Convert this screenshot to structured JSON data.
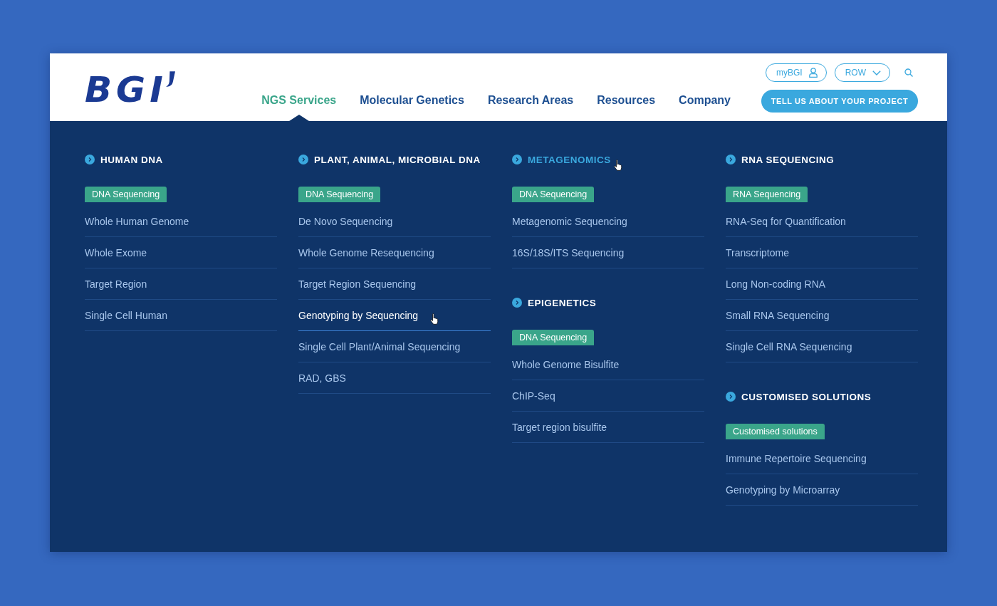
{
  "header": {
    "logo": "BGI",
    "nav": [
      {
        "label": "NGS Services",
        "selected": true
      },
      {
        "label": "Molecular Genetics",
        "selected": false
      },
      {
        "label": "Research Areas",
        "selected": false
      },
      {
        "label": "Resources",
        "selected": false
      },
      {
        "label": "Company",
        "selected": false
      }
    ],
    "account_button": "myBGI",
    "region_selector": "ROW",
    "cta_button": "TELL US ABOUT YOUR PROJECT"
  },
  "mega_menu": {
    "columns": [
      {
        "sections": [
          {
            "title": "HUMAN DNA",
            "hovered": false,
            "tag": "DNA Sequencing",
            "items": [
              {
                "label": "Whole Human Genome",
                "hovered": false
              },
              {
                "label": "Whole Exome",
                "hovered": false
              },
              {
                "label": "Target Region",
                "hovered": false
              },
              {
                "label": "Single Cell Human",
                "hovered": false
              }
            ]
          }
        ]
      },
      {
        "sections": [
          {
            "title": "PLANT, ANIMAL, MICROBIAL DNA",
            "hovered": false,
            "tag": "DNA Sequencing",
            "items": [
              {
                "label": "De Novo Sequencing",
                "hovered": false
              },
              {
                "label": "Whole Genome Resequencing",
                "hovered": false
              },
              {
                "label": "Target Region Sequencing",
                "hovered": false
              },
              {
                "label": "Genotyping by Sequencing",
                "hovered": true
              },
              {
                "label": "Single Cell Plant/Animal Sequencing",
                "hovered": false
              },
              {
                "label": "RAD, GBS",
                "hovered": false
              }
            ]
          }
        ]
      },
      {
        "sections": [
          {
            "title": "METAGENOMICS",
            "hovered": true,
            "tag": "DNA Sequencing",
            "items": [
              {
                "label": "Metagenomic Sequencing",
                "hovered": false
              },
              {
                "label": "16S/18S/ITS Sequencing",
                "hovered": false
              }
            ]
          },
          {
            "title": "EPIGENETICS",
            "hovered": false,
            "tag": "DNA Sequencing",
            "items": [
              {
                "label": "Whole Genome Bisulfite",
                "hovered": false
              },
              {
                "label": "ChIP-Seq",
                "hovered": false
              },
              {
                "label": "Target region bisulfite",
                "hovered": false
              }
            ]
          }
        ]
      },
      {
        "sections": [
          {
            "title": "RNA SEQUENCING",
            "hovered": false,
            "tag": "RNA Sequencing",
            "items": [
              {
                "label": "RNA-Seq for Quantification",
                "hovered": false
              },
              {
                "label": "Transcriptome",
                "hovered": false
              },
              {
                "label": "Long Non-coding RNA",
                "hovered": false
              },
              {
                "label": "Small RNA Sequencing",
                "hovered": false
              },
              {
                "label": "Single Cell RNA Sequencing",
                "hovered": false
              }
            ]
          },
          {
            "title": "CUSTOMISED SOLUTIONS",
            "hovered": false,
            "tag": "Customised solutions",
            "items": [
              {
                "label": "Immune Repertoire Sequencing",
                "hovered": false
              },
              {
                "label": "Genotyping by Microarray",
                "hovered": false
              }
            ]
          }
        ]
      }
    ]
  }
}
